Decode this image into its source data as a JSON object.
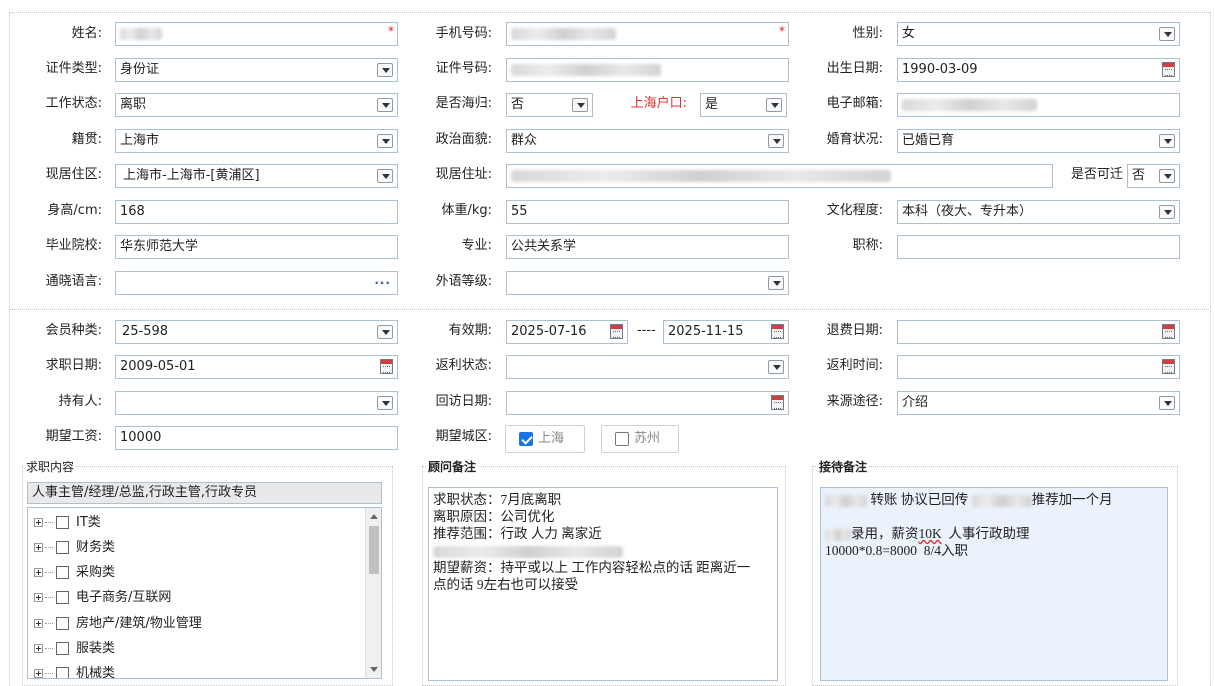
{
  "personal": {
    "name_label": "姓名:",
    "phone_label": "手机号码:",
    "gender_label": "性别:",
    "gender_value": "女",
    "id_type_label": "证件类型:",
    "id_type_value": "身份证",
    "id_number_label": "证件号码:",
    "birth_label": "出生日期:",
    "birth_value": "1990-03-09",
    "work_status_label": "工作状态:",
    "work_status_value": "离职",
    "returnee_label": "是否海归:",
    "returnee_value": "否",
    "shanghai_hukou_label": "上海户口:",
    "shanghai_hukou_value": "是",
    "email_label": "电子邮箱:",
    "native_label": "籍贯:",
    "native_value": "上海市",
    "political_label": "政治面貌:",
    "political_value": "群众",
    "marital_label": "婚育状况:",
    "marital_value": "已婚已育",
    "residence_label": "现居住区:",
    "residence_value": "上海市-上海市-[黄浦区]",
    "address_label": "现居住址:",
    "relocate_label": "是否可迁",
    "relocate_value": "否",
    "height_label": "身高/cm:",
    "height_value": "168",
    "weight_label": "体重/kg:",
    "weight_value": "55",
    "education_label": "文化程度:",
    "education_value": "本科（夜大、专升本）",
    "school_label": "毕业院校:",
    "school_value": "华东师范大学",
    "major_label": "专业:",
    "major_value": "公共关系学",
    "title_label": "职称:",
    "title_value": "",
    "language_label": "通晓语言:",
    "language_more": "···",
    "foreign_level_label": "外语等级:",
    "required_mark": "*"
  },
  "membership": {
    "member_type_label": "会员种类:",
    "member_type_value": "25-598",
    "valid_label": "有效期:",
    "valid_from": "2025-07-16",
    "valid_sep": "----",
    "valid_to": "2025-11-15",
    "refund_date_label": "退费日期:",
    "job_date_label": "求职日期:",
    "job_date_value": "2009-05-01",
    "rebate_status_label": "返利状态:",
    "rebate_time_label": "返利时间:",
    "holder_label": "持有人:",
    "revisit_label": "回访日期:",
    "source_label": "来源途径:",
    "source_value": "介绍",
    "salary_label": "期望工资:",
    "salary_value": "10000",
    "city_label": "期望城区:",
    "city_shanghai": "上海",
    "city_suzhou": "苏州"
  },
  "job_intent": {
    "title": "求职内容",
    "selected": "人事主管/经理/总监,行政主管,行政专员",
    "categories": [
      "IT类",
      "财务类",
      "采购类",
      "电子商务/互联网",
      "房地产/建筑/物业管理",
      "服装类",
      "机械类"
    ]
  },
  "advisor_notes": {
    "title": "顾问备注",
    "line1": "求职状态：7月底离职",
    "line2": "离职原因：公司优化",
    "line3": "推荐范围：行政 人力 离家近",
    "line5": "期望薪资：持平或以上 工作内容轻松点的话 距离近一",
    "line6": "点的话 9左右也可以接受"
  },
  "reception_notes": {
    "title": "接待备注",
    "line1_a": "转账 协议已回传",
    "line1_b": "推荐加一个月",
    "line3_a": "录用，薪资",
    "line3_k": "10K",
    "line3_b": "  人事行政助理",
    "line4": "10000*0.8=8000  8/4入职"
  }
}
